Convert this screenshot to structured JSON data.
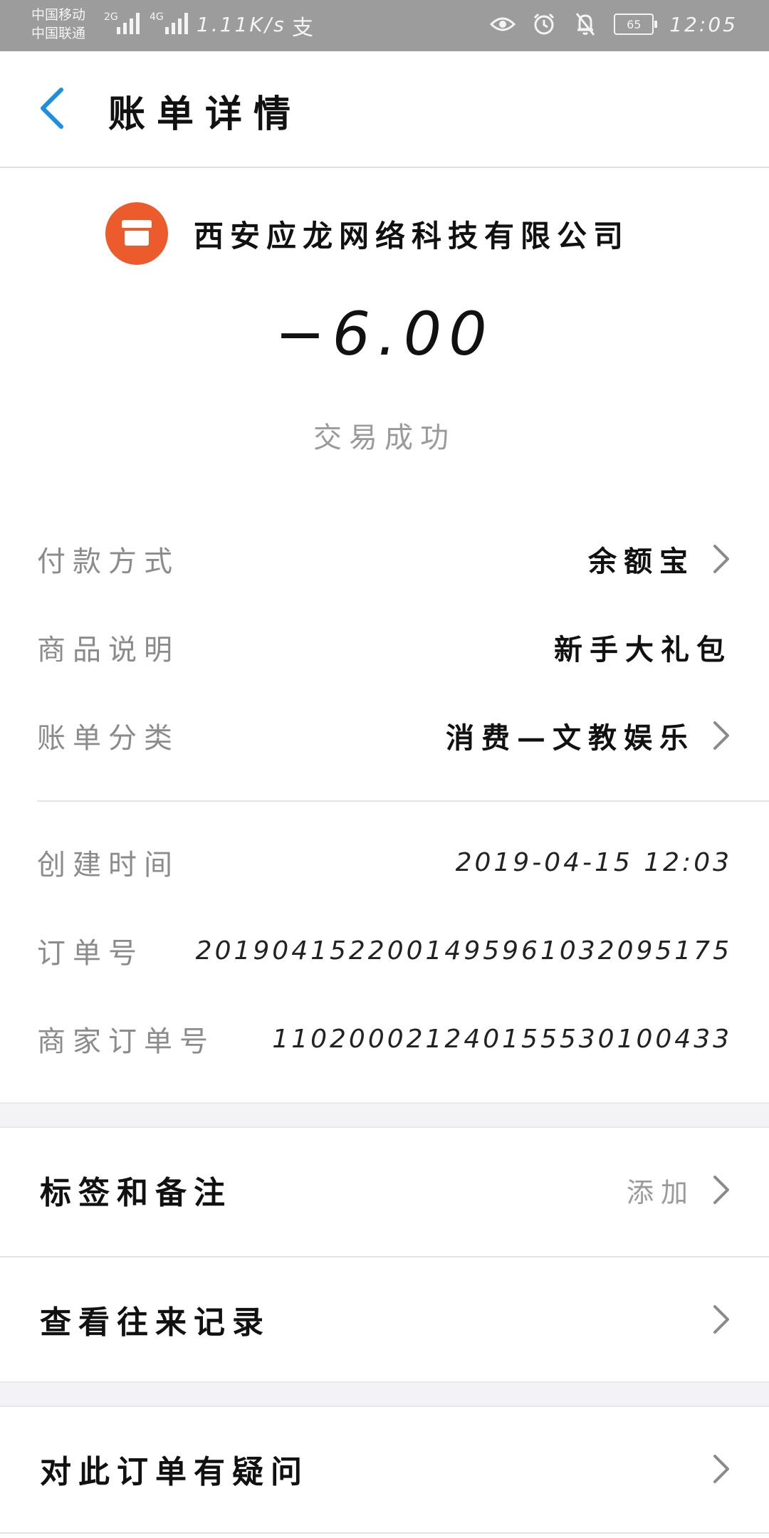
{
  "status_bar": {
    "carrier_1": "中国移动",
    "carrier_2": "中国联通",
    "tag_2g": "2G",
    "tag_4g": "4G",
    "speed": "1.11K/s",
    "alipay_mark": "支",
    "battery": "65",
    "time": "12:05"
  },
  "header": {
    "title": "账单详情"
  },
  "merchant": {
    "name": "西安应龙网络科技有限公司",
    "amount": "−6.00",
    "status": "交易成功"
  },
  "details": {
    "payment_method_label": "付款方式",
    "payment_method_value": "余额宝",
    "product_label": "商品说明",
    "product_value": "新手大礼包",
    "category_label": "账单分类",
    "category_value": "消费—文教娱乐",
    "created_label": "创建时间",
    "created_value": "2019-04-15  12:03",
    "order_label": "订单号",
    "order_value": "2019041522001495961032095175",
    "merchant_order_label": "商家订单号",
    "merchant_order_value": "110200021240155530100433"
  },
  "actions": {
    "tags_label": "标签和备注",
    "tags_extra": "添加",
    "history_label": "查看往来记录",
    "question_label": "对此订单有疑问"
  },
  "colors": {
    "accent": "#1a8fe3",
    "merchant_logo": "#ec5b2b",
    "status_bar": "#9c9c9c"
  }
}
